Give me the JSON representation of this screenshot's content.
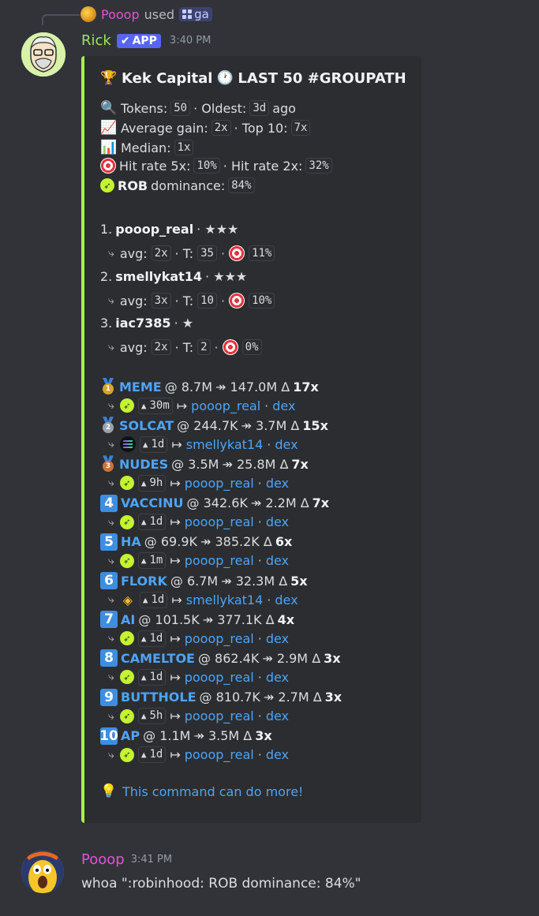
{
  "reply": {
    "user": "Pooop",
    "used": "used",
    "command": "ga"
  },
  "message1": {
    "username": "Rick",
    "badge": "APP",
    "time": "3:40 PM",
    "embed": {
      "title_name": "Kek Capital",
      "title_tag": "LAST 50 #GROUPATH",
      "stats": {
        "tokens_label": "Tokens:",
        "tokens": "50",
        "oldest_label": "· Oldest:",
        "oldest": "3d",
        "oldest_suffix": "ago",
        "avg_label": "Average gain:",
        "avg": "2x",
        "top10_label": "· Top 10:",
        "top10": "7x",
        "median_label": "Median:",
        "median": "1x",
        "hit5_label": "Hit rate 5x:",
        "hit5": "10%",
        "hit2_label": "· Hit rate 2x:",
        "hit2": "32%",
        "dom_name": "ROB",
        "dom_label": "dominance:",
        "dom": "84%"
      },
      "leaders": [
        {
          "rank": "1.",
          "name": "pooop_real",
          "stars": "· ★★★",
          "avg": "2x",
          "t": "35",
          "hit": "11%"
        },
        {
          "rank": "2.",
          "name": "smellykat14",
          "stars": "· ★★★",
          "avg": "3x",
          "t": "10",
          "hit": "10%"
        },
        {
          "rank": "3.",
          "name": "iac7385",
          "stars": "· ★",
          "avg": "2x",
          "t": "2",
          "hit": "0%"
        }
      ],
      "leader_labels": {
        "avg": "avg:",
        "t": "· T:"
      },
      "calls": [
        {
          "rank": "1",
          "ticker": "MEME",
          "from": "@ 8.7M",
          "to": "↠ 147.0M Δ",
          "mult": "17x",
          "age": "30m",
          "chain": "robinhood",
          "user": "pooop_real",
          "dex": "dex"
        },
        {
          "rank": "2",
          "ticker": "SOLCAT",
          "from": "@ 244.7K",
          "to": "↠ 3.7M Δ",
          "mult": "15x",
          "age": "1d",
          "chain": "solana",
          "user": "smellykat14",
          "dex": "dex"
        },
        {
          "rank": "3",
          "ticker": "NUDES",
          "from": "@ 3.5M",
          "to": "↠ 25.8M Δ",
          "mult": "7x",
          "age": "9h",
          "chain": "robinhood",
          "user": "pooop_real",
          "dex": "dex"
        },
        {
          "rank": "4",
          "ticker": "VACCINU",
          "from": "@ 342.6K",
          "to": "↠ 2.2M Δ",
          "mult": "7x",
          "age": "1d",
          "chain": "robinhood",
          "user": "pooop_real",
          "dex": "dex"
        },
        {
          "rank": "5",
          "ticker": "HA",
          "from": "@ 69.9K",
          "to": "↠ 385.2K Δ",
          "mult": "6x",
          "age": "1m",
          "chain": "robinhood",
          "user": "pooop_real",
          "dex": "dex"
        },
        {
          "rank": "6",
          "ticker": "FLORK",
          "from": "@ 6.7M",
          "to": "↠ 32.3M Δ",
          "mult": "5x",
          "age": "1d",
          "chain": "bnb",
          "user": "smellykat14",
          "dex": "dex"
        },
        {
          "rank": "7",
          "ticker": "AI",
          "from": "@ 101.5K",
          "to": "↠ 377.1K Δ",
          "mult": "4x",
          "age": "1d",
          "chain": "robinhood",
          "user": "pooop_real",
          "dex": "dex"
        },
        {
          "rank": "8",
          "ticker": "CAMELTOE",
          "from": "@ 862.4K",
          "to": "↠ 2.9M Δ",
          "mult": "3x",
          "age": "1d",
          "chain": "robinhood",
          "user": "pooop_real",
          "dex": "dex"
        },
        {
          "rank": "9",
          "ticker": "BUTTHOLE",
          "from": "@ 810.7K",
          "to": "↠ 2.7M Δ",
          "mult": "3x",
          "age": "5h",
          "chain": "robinhood",
          "user": "pooop_real",
          "dex": "dex"
        },
        {
          "rank": "10",
          "ticker": "AP",
          "from": "@ 1.1M",
          "to": "↠ 3.5M Δ",
          "mult": "3x",
          "age": "1d",
          "chain": "robinhood",
          "user": "pooop_real",
          "dex": "dex"
        }
      ],
      "footer": "This command can do more!"
    }
  },
  "message2": {
    "username": "Pooop",
    "time": "3:41 PM",
    "text": "whoa \":robinhood: ROB dominance: 84%\""
  },
  "colors": {
    "accent_bar": "#a5f24a",
    "link": "#4ea4f6",
    "rick": "#9be55c",
    "pooop": "#e153d8",
    "app_badge": "#5865f2"
  }
}
